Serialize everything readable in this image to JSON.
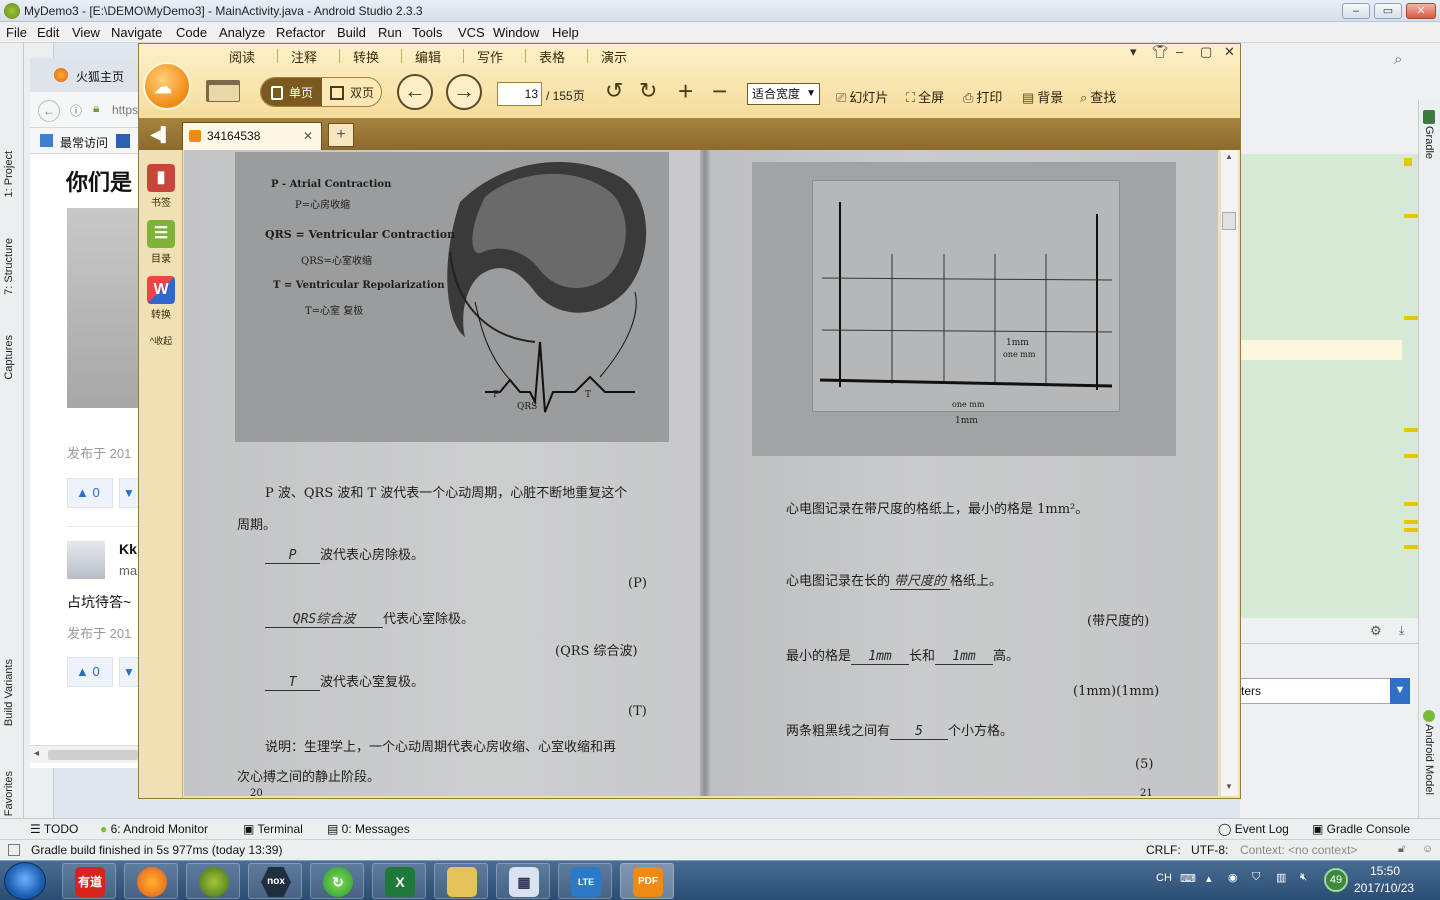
{
  "as": {
    "title": "MyDemo3 - [E:\\DEMO\\MyDemo3] - MainActivity.java - Android Studio 2.3.3",
    "menu": [
      "File",
      "Edit",
      "View",
      "Navigate",
      "Code",
      "Analyze",
      "Refactor",
      "Build",
      "Run",
      "Tools",
      "VCS",
      "Window",
      "Help"
    ],
    "left_tabs": [
      "1: Project",
      "7: Structure",
      "Captures",
      "Build Variants",
      "2: Favorites"
    ],
    "right_tabs": [
      "Gradle",
      "Android Model"
    ],
    "right_filter_text": "ters",
    "bottom_tabs": [
      "TODO",
      "6: Android Monitor",
      "Terminal",
      "0: Messages",
      "Event Log",
      "Gradle Console"
    ],
    "status_left": "Gradle build finished in 5s 977ms (today 13:39)",
    "status_right": [
      "CRLF:",
      "UTF-8:",
      "Context: <no context>"
    ]
  },
  "firefox": {
    "tab": "火狐主页",
    "url": "https",
    "bookmark": "最常访问",
    "heading": "你们是",
    "posted1": "发布于 201",
    "vote_up": "0",
    "user_short": "Kk",
    "user_sub": "ma",
    "comment": "占坑待答~",
    "posted2": "发布于 201",
    "vote_up2": "0"
  },
  "reader": {
    "menu": [
      "阅读",
      "注释",
      "转换",
      "编辑",
      "写作",
      "表格",
      "演示"
    ],
    "logo": "",
    "view_single": "单页",
    "view_double": "双页",
    "page_current": "13",
    "page_total": "/ 155页",
    "zoom": "适合宽度",
    "tools": [
      "幻灯片",
      "全屏",
      "打印",
      "背景",
      "查找"
    ],
    "tab_title": "34164538",
    "side": [
      "书签",
      "目录",
      "转换",
      "收起"
    ]
  },
  "doc": {
    "left": {
      "fig_labels": [
        "P - Atrial Contraction",
        "P=心房收缩",
        "QRS = Ventricular Contraction",
        "QRS=心室收缩",
        "T = Ventricular Repolarization",
        "T=心室 复极"
      ],
      "wave_labels": [
        "P",
        "QRS",
        "T"
      ],
      "para1_l1": "P 波、QRS 波和 T 波代表一个心动周期，心脏不断地重复这个",
      "para1_l2": "周期。",
      "q1_answer": "P",
      "q1_text": "波代表心房除极。",
      "q1_key": "(P)",
      "q2_answer": "QRS综合波",
      "q2_text": "代表心室除极。",
      "q2_key": "(QRS 综合波)",
      "q3_answer": "T",
      "q3_text": "波代表心室复极。",
      "q3_key": "(T)",
      "note_l1": "说明：生理学上，一个心动周期代表心房收缩、心室收缩和再",
      "note_l2": "次心搏之间的静止阶段。",
      "page_no": "20"
    },
    "right": {
      "fig_labels": [
        "1mm",
        "one mm",
        "one mm",
        "1mm"
      ],
      "line1": "心电图记录在带尺度的格纸上，最小的格是 1mm²。",
      "q1_pre": "心电图记录在长的",
      "q1_answer": "带尺度的",
      "q1_post": "格纸上。",
      "q1_key": "(带尺度的)",
      "q2_pre": "最小的格是",
      "q2_a1": "1mm",
      "q2_mid": "长和",
      "q2_a2": "1mm",
      "q2_post": "高。",
      "q2_key": "(1mm)(1mm)",
      "q3_pre": "两条粗黑线之间有",
      "q3_answer": "5",
      "q3_post": "个小方格。",
      "q3_key": "(5)",
      "page_no": "21"
    }
  },
  "taskbar": {
    "apps": [
      "有道",
      "Firefox",
      "Android Studio",
      "nox",
      "360",
      "Excel",
      "Folder",
      "Calculator",
      "LTE",
      "PDF"
    ],
    "ime": "CH",
    "badge": "49",
    "time": "15:50",
    "date": "2017/10/23"
  }
}
